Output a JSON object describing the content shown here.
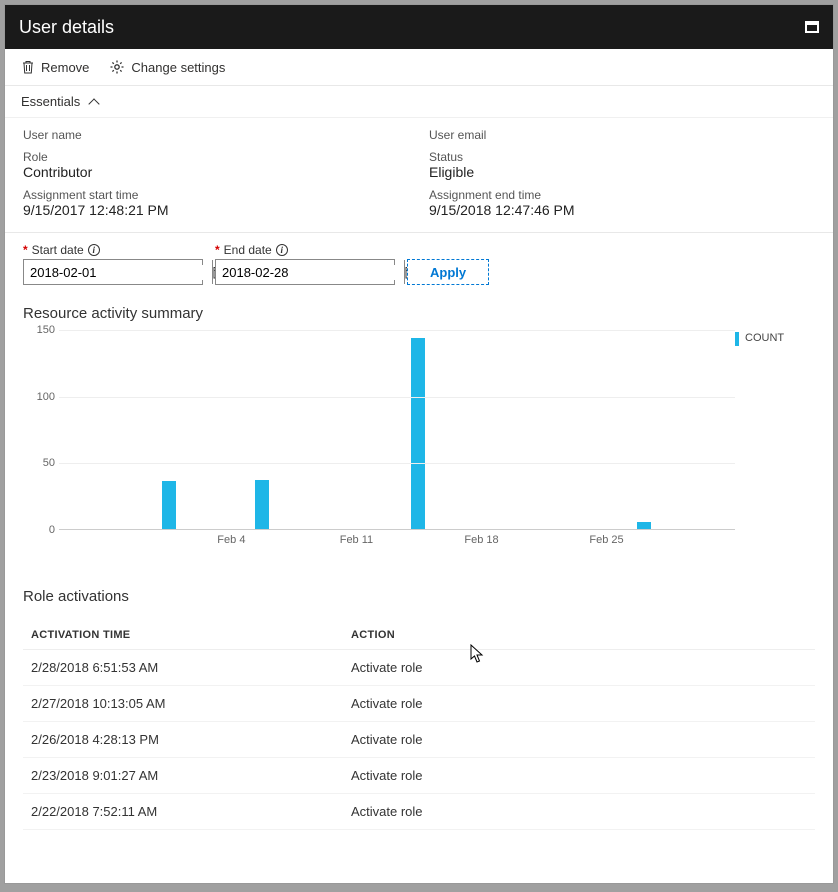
{
  "titlebar": {
    "title": "User details"
  },
  "toolbar": {
    "remove_label": "Remove",
    "settings_label": "Change settings"
  },
  "essentials": {
    "header": "Essentials",
    "username_label": "User name",
    "username_value": "",
    "useremail_label": "User email",
    "useremail_value": "",
    "role_label": "Role",
    "role_value": "Contributor",
    "status_label": "Status",
    "status_value": "Eligible",
    "start_label": "Assignment start time",
    "start_value": "9/15/2017 12:48:21 PM",
    "end_label": "Assignment end time",
    "end_value": "9/15/2018 12:47:46 PM"
  },
  "filter": {
    "start_label": "Start date",
    "start_value": "2018-02-01",
    "end_label": "End date",
    "end_value": "2018-02-28",
    "apply_label": "Apply"
  },
  "activity": {
    "title": "Resource activity summary",
    "legend": "COUNT"
  },
  "chart_data": {
    "type": "bar",
    "title": "Resource activity summary",
    "ylabel": "COUNT",
    "ylim": [
      0,
      150
    ],
    "y_ticks": [
      0,
      50,
      100,
      150
    ],
    "x_tick_labels": [
      "Feb 4",
      "Feb 11",
      "Feb 18",
      "Feb 25"
    ],
    "bars": [
      {
        "x_pct": 15.2,
        "value": 36
      },
      {
        "x_pct": 29.0,
        "value": 37
      },
      {
        "x_pct": 52.0,
        "value": 143
      },
      {
        "x_pct": 85.5,
        "value": 5
      }
    ]
  },
  "role_activations": {
    "title": "Role activations",
    "col_time": "ACTIVATION TIME",
    "col_action": "ACTION",
    "rows": [
      {
        "time": "2/28/2018 6:51:53 AM",
        "action": "Activate role"
      },
      {
        "time": "2/27/2018 10:13:05 AM",
        "action": "Activate role"
      },
      {
        "time": "2/26/2018 4:28:13 PM",
        "action": "Activate role"
      },
      {
        "time": "2/23/2018 9:01:27 AM",
        "action": "Activate role"
      },
      {
        "time": "2/22/2018 7:52:11 AM",
        "action": "Activate role"
      }
    ]
  },
  "colors": {
    "accent": "#1eb6e7",
    "link": "#0078d4"
  }
}
